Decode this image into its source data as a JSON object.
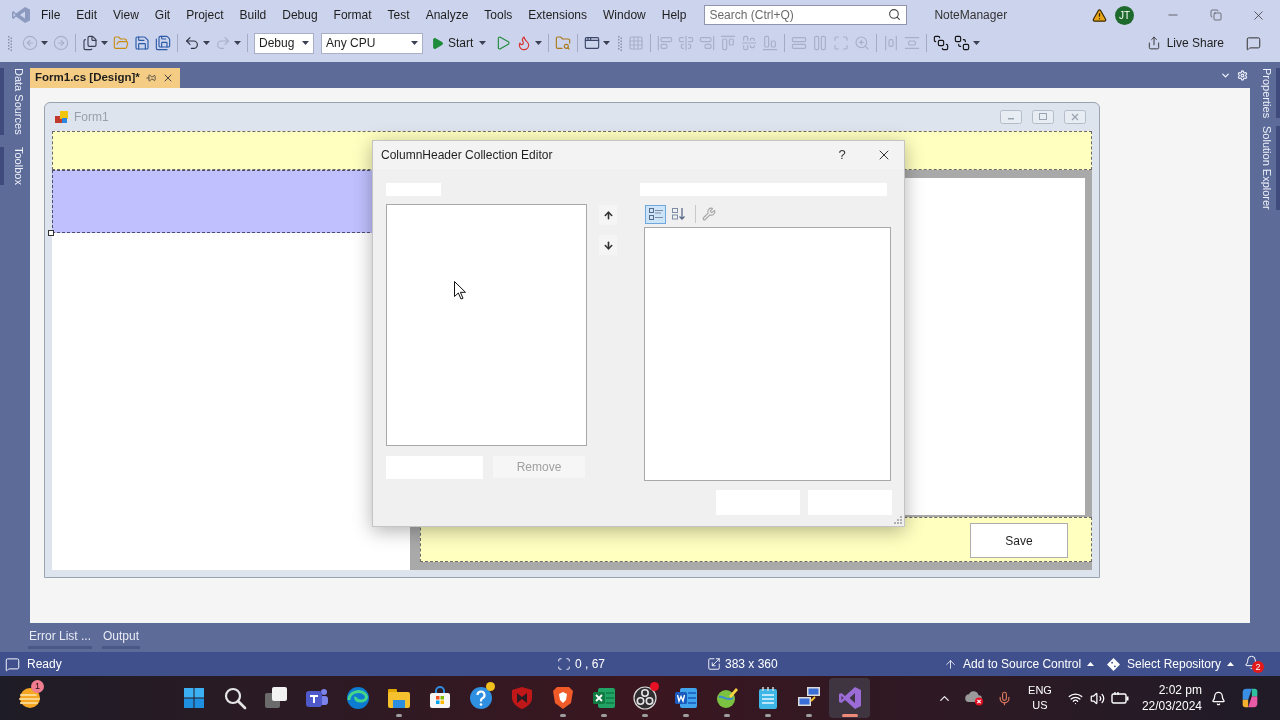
{
  "title_bar": {
    "menu": [
      "File",
      "Edit",
      "View",
      "Git",
      "Project",
      "Build",
      "Debug",
      "Format",
      "Test",
      "Analyze",
      "Tools",
      "Extensions",
      "Window",
      "Help"
    ],
    "search": {
      "placeholder": "Search (Ctrl+Q)"
    },
    "solution": "NoteManager",
    "account": "JT"
  },
  "toolbar": {
    "groups_left": [
      [
        {
          "kind": "back",
          "disabled": true,
          "dropdown": true
        },
        {
          "kind": "forward",
          "disabled": true,
          "dropdown": false
        }
      ],
      [
        {
          "kind": "new_item",
          "disabled": false,
          "dropdown": true
        },
        {
          "kind": "open",
          "disabled": false,
          "dropdown": false
        },
        {
          "kind": "save",
          "disabled": false,
          "dropdown": false
        },
        {
          "kind": "save_all",
          "disabled": false,
          "dropdown": false
        }
      ],
      [
        {
          "kind": "undo",
          "disabled": false,
          "dropdown": true
        },
        {
          "kind": "redo",
          "disabled": true,
          "dropdown": true
        }
      ]
    ],
    "configuration": "Debug",
    "platform": "Any CPU",
    "start": "Start",
    "groups_right": [
      [
        {
          "kind": "run_no_debug",
          "disabled": false,
          "dropdown": false
        },
        {
          "kind": "hot_reload",
          "disabled": false,
          "dropdown": true
        }
      ],
      [
        {
          "kind": "find",
          "disabled": false,
          "dropdown": false
        }
      ],
      [
        {
          "kind": "browser",
          "disabled": false,
          "dropdown": true
        }
      ]
    ],
    "layout_groups": [
      [
        {
          "kind": "align_grid",
          "disabled": true,
          "dropdown": false
        }
      ],
      [
        {
          "kind": "align_left",
          "disabled": true,
          "dropdown": false
        },
        {
          "kind": "align_center",
          "disabled": true,
          "dropdown": false
        },
        {
          "kind": "align_right",
          "disabled": true,
          "dropdown": false
        },
        {
          "kind": "align_top",
          "disabled": true,
          "dropdown": false
        },
        {
          "kind": "align_middle",
          "disabled": true,
          "dropdown": false
        },
        {
          "kind": "align_bottom",
          "disabled": true,
          "dropdown": false
        }
      ],
      [
        {
          "kind": "same_width",
          "disabled": true,
          "dropdown": false
        },
        {
          "kind": "same_height",
          "disabled": true,
          "dropdown": false
        },
        {
          "kind": "same_size",
          "disabled": true,
          "dropdown": false
        },
        {
          "kind": "zoom",
          "disabled": true,
          "dropdown": false
        }
      ],
      [
        {
          "kind": "h_spacing",
          "disabled": true,
          "dropdown": false
        },
        {
          "kind": "v_spacing",
          "disabled": true,
          "dropdown": false
        }
      ],
      [
        {
          "kind": "bring_front",
          "disabled": false,
          "dropdown": false
        },
        {
          "kind": "send_back",
          "disabled": false,
          "dropdown": true
        }
      ]
    ],
    "live_share": "Live Share"
  },
  "tool_tabs_left": [
    "Data Sources",
    "Toolbox"
  ],
  "tool_tabs_right": [
    "Properties",
    "Solution Explorer"
  ],
  "document_tab": {
    "title": "Form1.cs [Design]*",
    "selected": true
  },
  "designer": {
    "form_title": "Form1",
    "save_button": "Save"
  },
  "dialog": {
    "title": "ColumnHeader Collection Editor",
    "help": "?",
    "view_buttons": [
      {
        "kind": "categorized",
        "selected": true
      },
      {
        "kind": "alphabetical",
        "selected": false
      }
    ],
    "property_pages": {
      "disabled": true
    },
    "remove_button": {
      "label": "Remove",
      "disabled": true
    }
  },
  "bottom_tabs": [
    "Error List ...",
    "Output"
  ],
  "status_bar": {
    "message": "Ready",
    "position": "0 , 67",
    "size": "383 x 360",
    "source_control": "Add to Source Control",
    "repository": "Select Repository",
    "notifications": "2"
  },
  "taskbar": {
    "widget_badge": "1",
    "apps": [
      {
        "kind": "start",
        "running": false,
        "selected": false
      },
      {
        "kind": "search",
        "running": false,
        "selected": false
      },
      {
        "kind": "task_view",
        "running": false,
        "selected": false
      },
      {
        "kind": "chat",
        "running": false,
        "selected": false
      },
      {
        "kind": "web_browser",
        "running": false,
        "selected": false
      },
      {
        "kind": "files",
        "running": true,
        "selected": false
      },
      {
        "kind": "store",
        "running": false,
        "selected": false
      },
      {
        "kind": "help",
        "running": false,
        "selected": false,
        "color": "#f2c01e"
      },
      {
        "kind": "security",
        "running": false,
        "selected": false
      },
      {
        "kind": "browser_shield",
        "running": true,
        "selected": false
      },
      {
        "kind": "spreadsheet",
        "running": true,
        "selected": false
      },
      {
        "kind": "recorder",
        "running": true,
        "selected": false,
        "color": "#e81123"
      },
      {
        "kind": "document",
        "running": true,
        "selected": false
      },
      {
        "kind": "maps",
        "running": true,
        "selected": false
      },
      {
        "kind": "notepad",
        "running": true,
        "selected": false
      },
      {
        "kind": "network",
        "running": true,
        "selected": false
      },
      {
        "kind": "ide",
        "running": true,
        "selected": true
      }
    ],
    "language": "ENG",
    "region": "US",
    "time": "2:02 pm",
    "date": "22/03/2024"
  }
}
